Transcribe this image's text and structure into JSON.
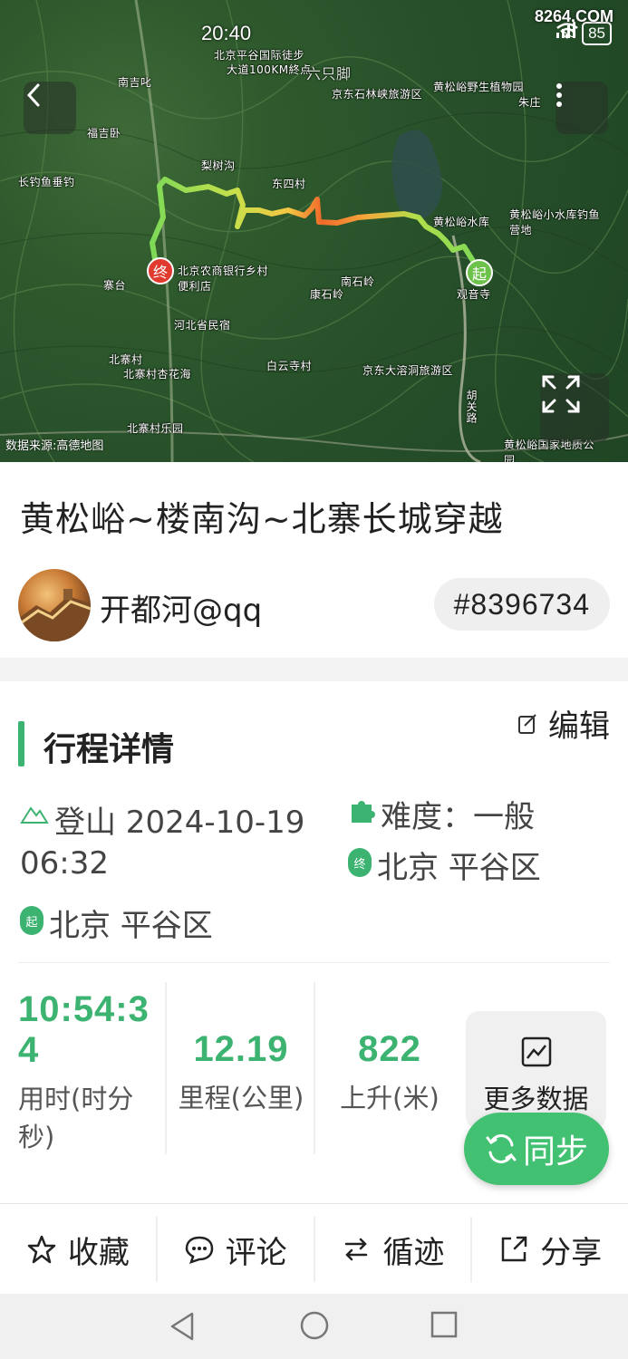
{
  "status_bar": {
    "time": "20:40",
    "battery": "85",
    "network": "5G"
  },
  "watermark": "8264.COM",
  "map": {
    "source": "数据来源:高德地图",
    "labels": [
      "北京平谷国际徒步",
      "大道100KM終点",
      "六只脚",
      "南吉叱",
      "京东石林峡旅游区",
      "黄松峪野生植物园",
      "朱庄",
      "福吉卧",
      "长钓鱼垂钓",
      "梨树沟",
      "东四村",
      "黄松峪水库",
      "黄松峪小水库钓鱼营地",
      "北京农商银行乡村便利店",
      "寨台",
      "观音寺",
      "康石岭",
      "南石岭",
      "河北省民宿",
      "北寨村",
      "北寨村杏花海",
      "白云寺村",
      "京东大溶洞旅游区",
      "北寨村乐园",
      "胡关路",
      "黄松峪国家地质公园"
    ],
    "start_marker": "起",
    "end_marker": "终"
  },
  "header": {
    "title": "黄松峪~楼南沟~北寨长城穿越",
    "author": "开都河@qq",
    "route_id": "#8396734"
  },
  "details": {
    "section_title": "行程详情",
    "edit_label": "编辑",
    "activity": "登山 2024-10-19",
    "activity_time": "06:32",
    "difficulty": "难度：一般",
    "end_location": "北京 平谷区",
    "start_location": "北京 平谷区",
    "end_badge": "终",
    "start_badge": "起"
  },
  "stats": {
    "duration_value_line1": "10:54:3",
    "duration_value_line2": "4",
    "duration_label_line1": "用时(时分",
    "duration_label_line2": "秒)",
    "distance_value": "12.19",
    "distance_label": "里程(公里)",
    "ascent_value": "822",
    "ascent_label": "上升(米)",
    "more_data_label": "更多数据",
    "sync_label": "同步"
  },
  "actions": {
    "favorite": "收藏",
    "comment": "评论",
    "follow_track": "循迹",
    "share": "分享"
  },
  "colors": {
    "accent": "#3cb371",
    "sync_button": "#43c173",
    "track_start": "#7ed957",
    "track_mid": "#f5c542",
    "track_hot": "#f06a2a"
  }
}
